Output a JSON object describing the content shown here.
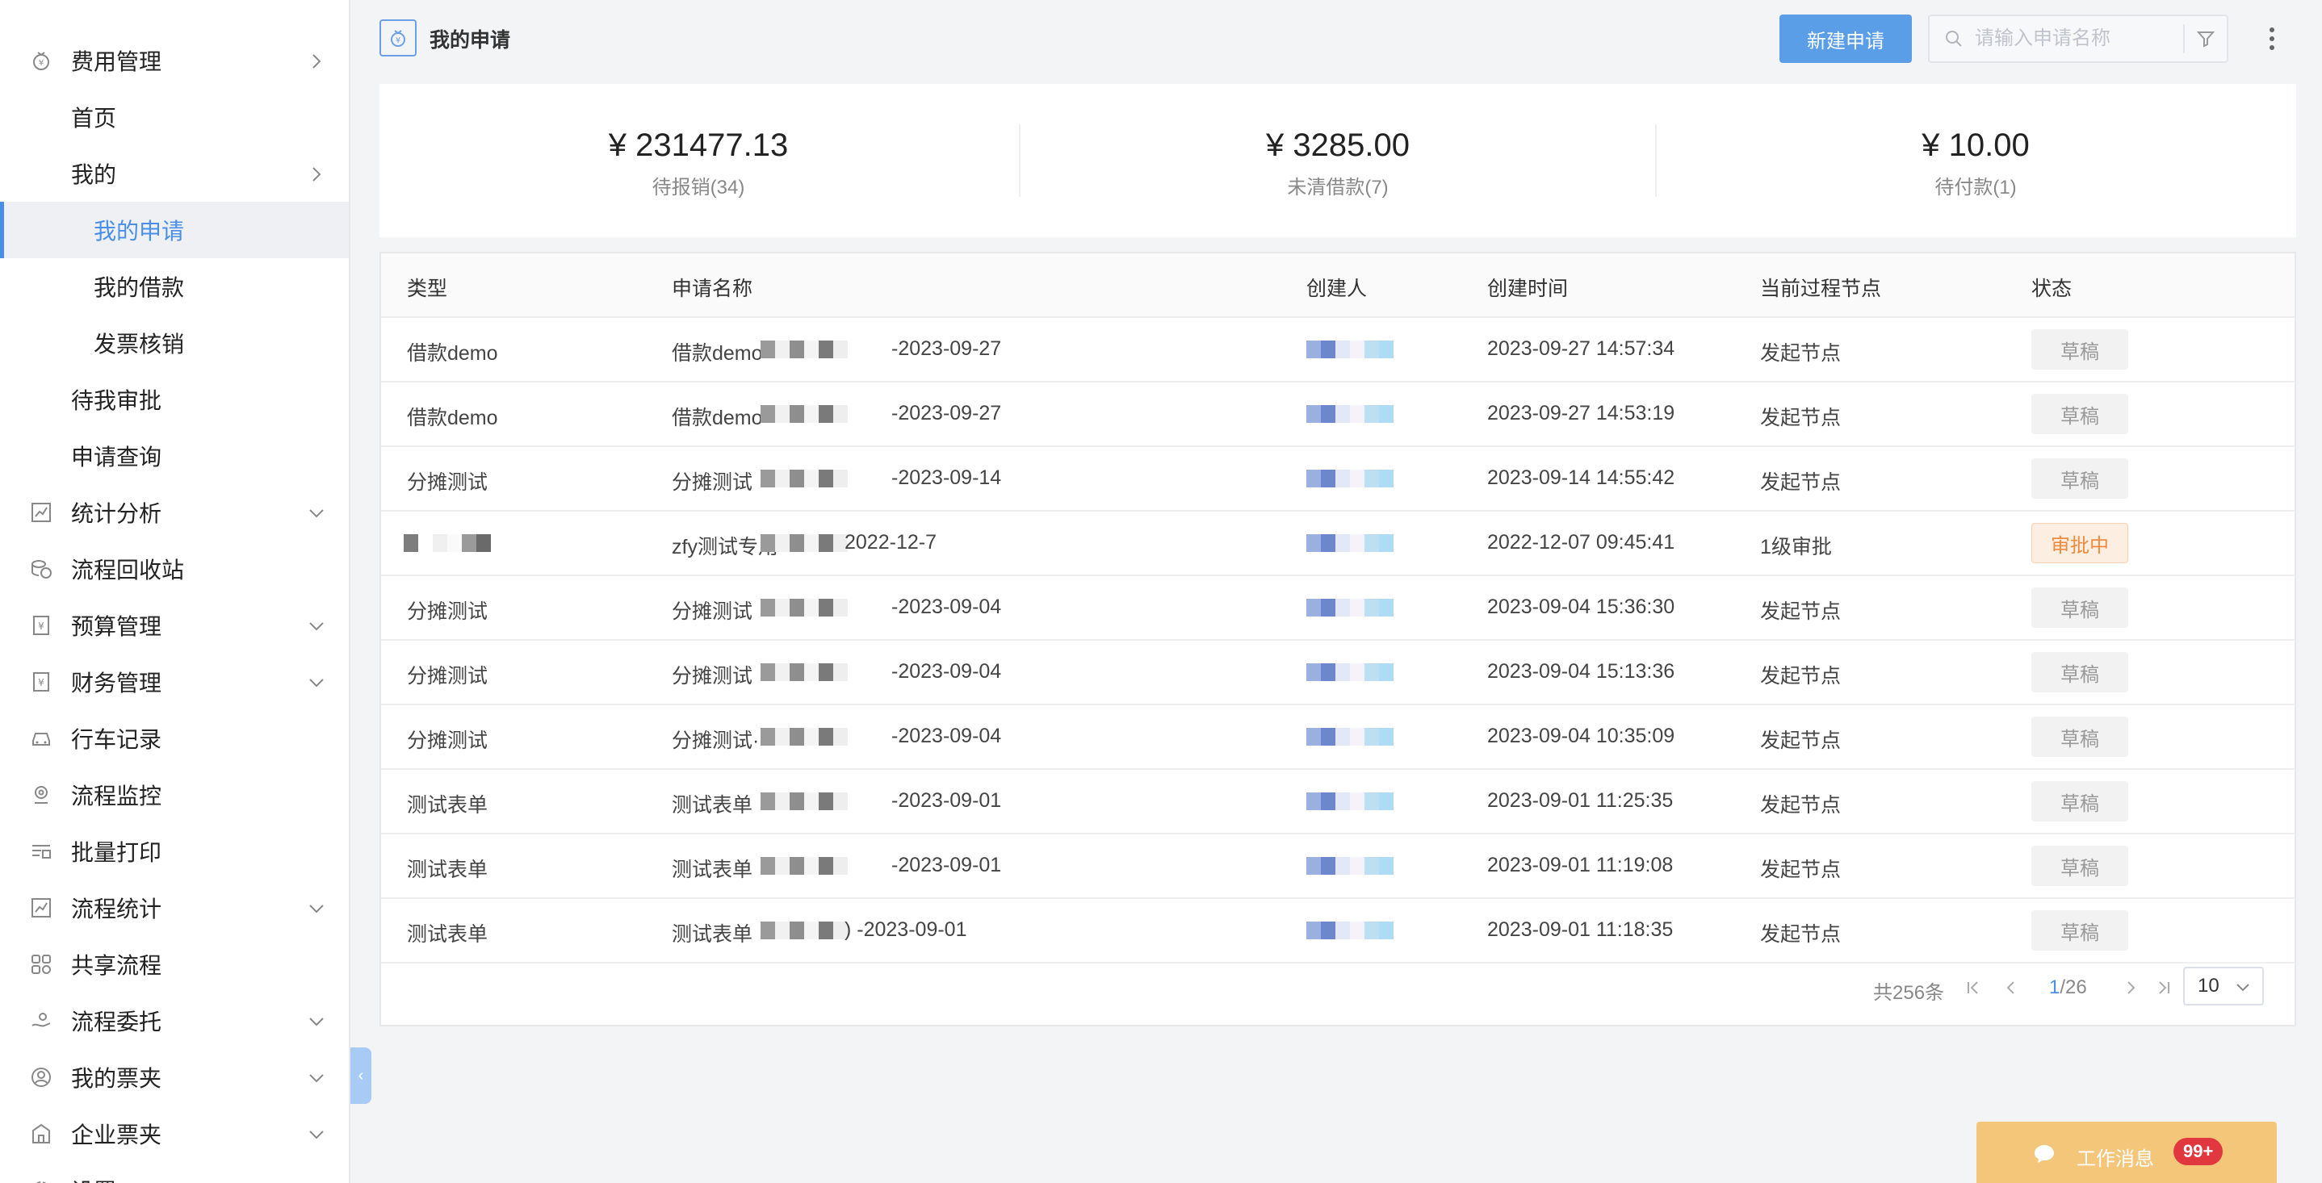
{
  "sidebar": {
    "items": [
      {
        "label": "费用管理",
        "level": 1,
        "icon": "money-bag-icon",
        "arrow": "right"
      },
      {
        "label": "首页",
        "level": 2
      },
      {
        "label": "我的",
        "level": 2,
        "arrow": "right"
      },
      {
        "label": "我的申请",
        "level": 3,
        "active": true
      },
      {
        "label": "我的借款",
        "level": 3
      },
      {
        "label": "发票核销",
        "level": 3
      },
      {
        "label": "待我审批",
        "level": 2
      },
      {
        "label": "申请查询",
        "level": 2
      },
      {
        "label": "统计分析",
        "level": 1,
        "icon": "chart-icon",
        "arrow": "down"
      },
      {
        "label": "流程回收站",
        "level": 1,
        "icon": "recycle-icon"
      },
      {
        "label": "预算管理",
        "level": 1,
        "icon": "budget-icon",
        "arrow": "down"
      },
      {
        "label": "财务管理",
        "level": 1,
        "icon": "finance-icon",
        "arrow": "down"
      },
      {
        "label": "行车记录",
        "level": 1,
        "icon": "car-icon"
      },
      {
        "label": "流程监控",
        "level": 1,
        "icon": "monitor-icon"
      },
      {
        "label": "批量打印",
        "level": 1,
        "icon": "print-icon"
      },
      {
        "label": "流程统计",
        "level": 1,
        "icon": "stats-icon",
        "arrow": "down"
      },
      {
        "label": "共享流程",
        "level": 1,
        "icon": "share-icon"
      },
      {
        "label": "流程委托",
        "level": 1,
        "icon": "delegate-icon",
        "arrow": "down"
      },
      {
        "label": "我的票夹",
        "level": 1,
        "icon": "user-circle-icon",
        "arrow": "down"
      },
      {
        "label": "企业票夹",
        "level": 1,
        "icon": "building-icon",
        "arrow": "down"
      },
      {
        "label": "设置",
        "level": 1,
        "icon": "settings-icon"
      }
    ]
  },
  "header": {
    "title": "我的申请",
    "new_button": "新建申请",
    "search_placeholder": "请输入申请名称"
  },
  "summary": [
    {
      "amount": "¥ 231477.13",
      "label": "待报销(34)"
    },
    {
      "amount": "¥ 3285.00",
      "label": "未清借款(7)"
    },
    {
      "amount": "¥ 10.00",
      "label": "待付款(1)"
    }
  ],
  "table": {
    "columns": [
      "类型",
      "申请名称",
      "创建人",
      "创建时间",
      "当前过程节点",
      "状态"
    ],
    "rows": [
      {
        "type": "借款demo",
        "name_prefix": "借款demo",
        "name_suffix": "-2023-09-27",
        "time": "2023-09-27 14:57:34",
        "node": "发起节点",
        "status": "草稿",
        "status_kind": "draft"
      },
      {
        "type": "借款demo",
        "name_prefix": "借款demo",
        "name_suffix": "-2023-09-27",
        "time": "2023-09-27 14:53:19",
        "node": "发起节点",
        "status": "草稿",
        "status_kind": "draft"
      },
      {
        "type": "分摊测试",
        "name_prefix": "分摊测试",
        "name_suffix": "-2023-09-14",
        "time": "2023-09-14 14:55:42",
        "node": "发起节点",
        "status": "草稿",
        "status_kind": "draft"
      },
      {
        "type": "",
        "name_prefix": "zfy测试专用",
        "name_suffix": "2022-12-7",
        "time": "2022-12-07 09:45:41",
        "node": "1级审批",
        "status": "审批中",
        "status_kind": "pending"
      },
      {
        "type": "分摊测试",
        "name_prefix": "分摊测试",
        "name_suffix": "-2023-09-04",
        "time": "2023-09-04 15:36:30",
        "node": "发起节点",
        "status": "草稿",
        "status_kind": "draft"
      },
      {
        "type": "分摊测试",
        "name_prefix": "分摊测试",
        "name_suffix": "-2023-09-04",
        "time": "2023-09-04 15:13:36",
        "node": "发起节点",
        "status": "草稿",
        "status_kind": "draft"
      },
      {
        "type": "分摊测试",
        "name_prefix": "分摊测试·",
        "name_suffix": "-2023-09-04",
        "time": "2023-09-04 10:35:09",
        "node": "发起节点",
        "status": "草稿",
        "status_kind": "draft"
      },
      {
        "type": "测试表单",
        "name_prefix": "测试表单",
        "name_suffix": "-2023-09-01",
        "time": "2023-09-01 11:25:35",
        "node": "发起节点",
        "status": "草稿",
        "status_kind": "draft"
      },
      {
        "type": "测试表单",
        "name_prefix": "测试表单",
        "name_suffix": "-2023-09-01",
        "time": "2023-09-01 11:19:08",
        "node": "发起节点",
        "status": "草稿",
        "status_kind": "draft"
      },
      {
        "type": "测试表单",
        "name_prefix": "测试表单",
        "name_suffix": ") -2023-09-01",
        "time": "2023-09-01 11:18:35",
        "node": "发起节点",
        "status": "草稿",
        "status_kind": "draft"
      }
    ]
  },
  "pagination": {
    "total": "共256条",
    "current": "1",
    "pages": "/26",
    "page_size": "10"
  },
  "messages": {
    "label": "工作消息",
    "count": "99+"
  },
  "colors": {
    "accent": "#4a8fe7",
    "button": "#5b9ee8",
    "pending": "#f08a3c",
    "message_bar": "#f3c67a",
    "badge_red": "#e0383e"
  }
}
